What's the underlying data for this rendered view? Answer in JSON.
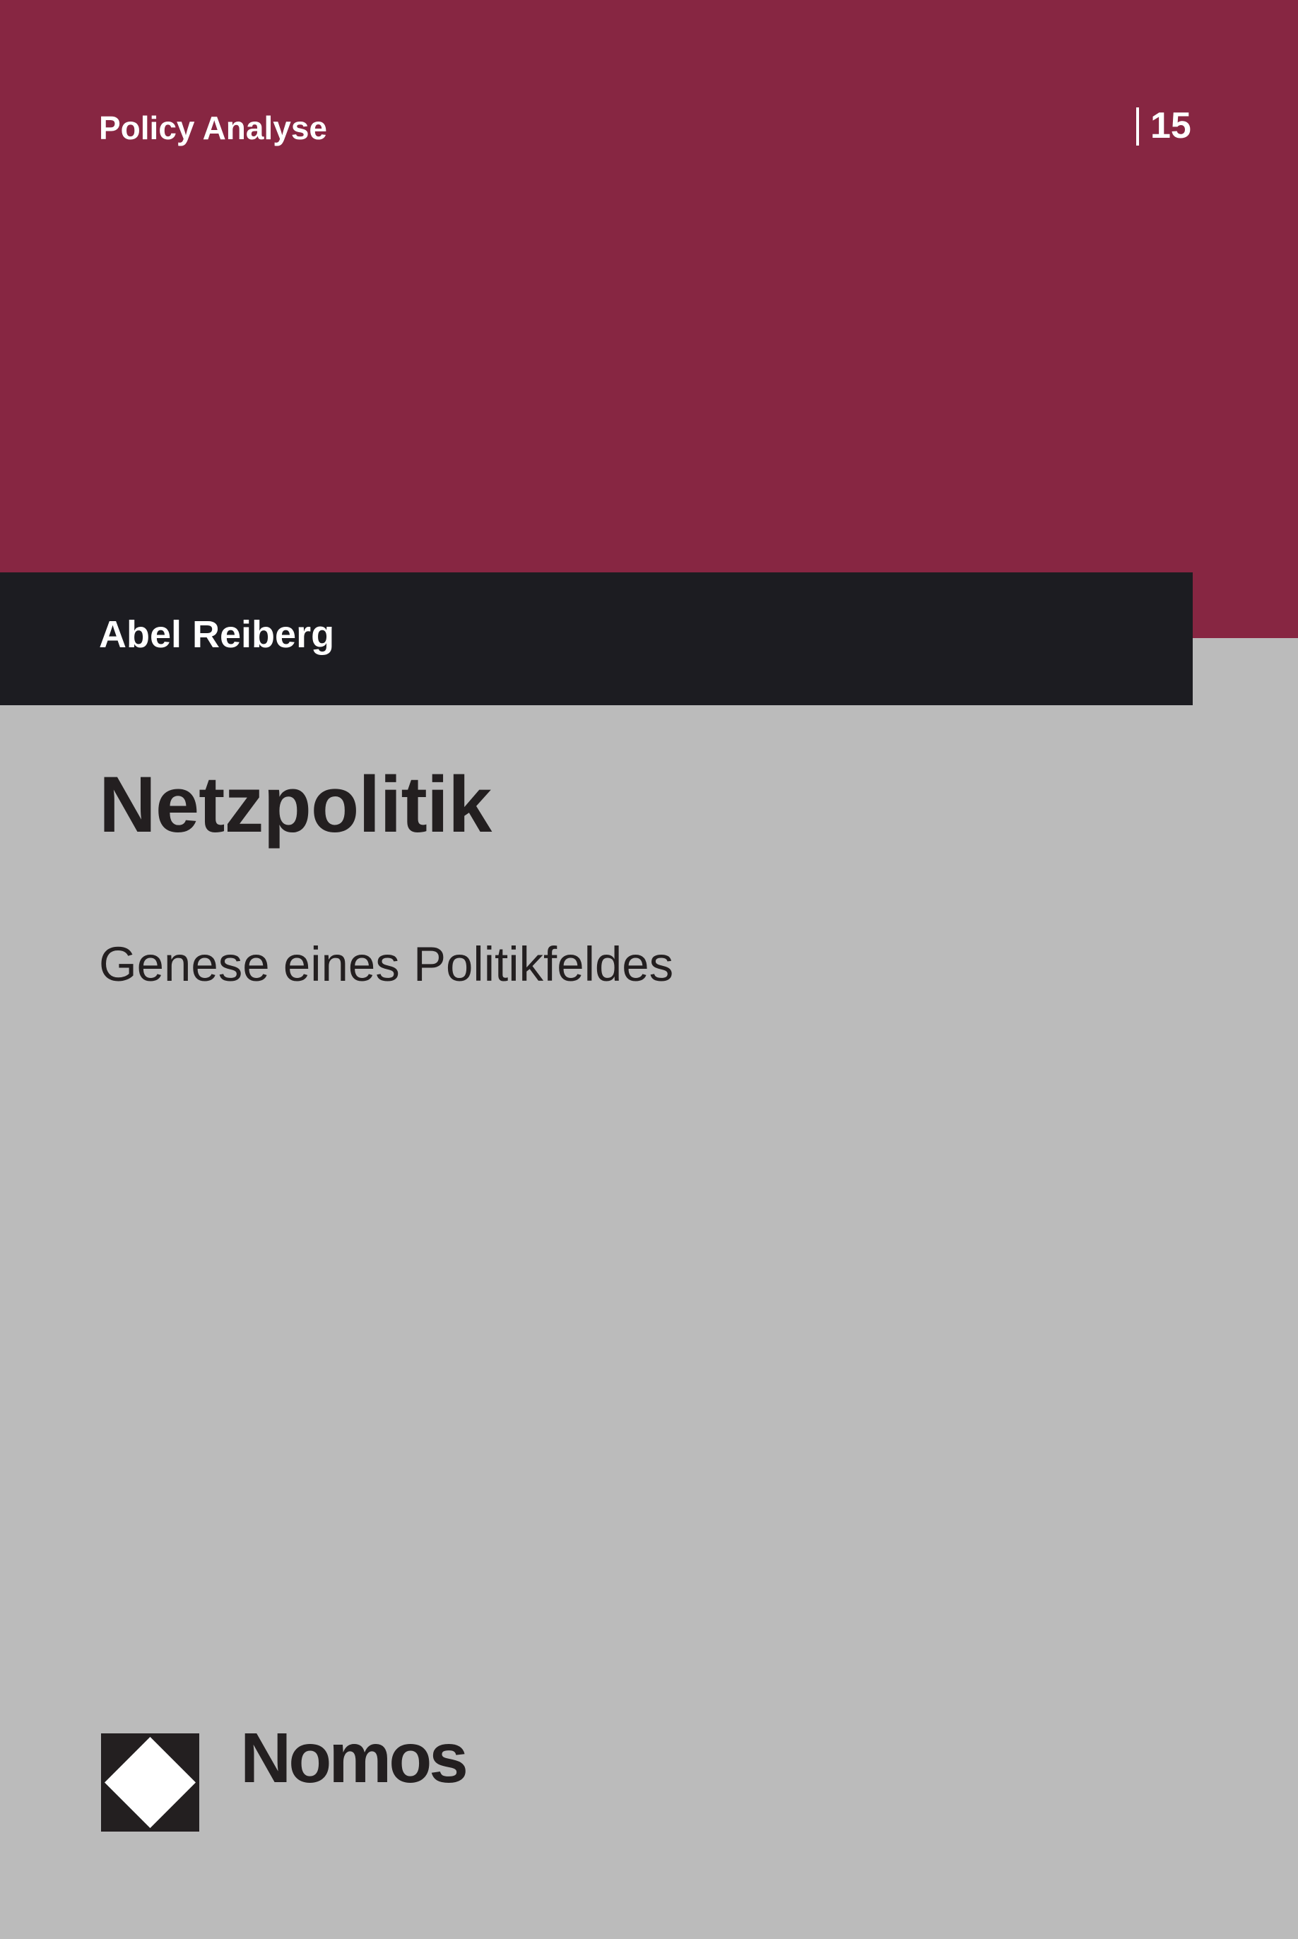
{
  "series": {
    "label": "Policy Analyse",
    "volume": "15"
  },
  "author": {
    "name": "Abel Reiberg"
  },
  "book": {
    "title": "Netzpolitik",
    "subtitle": "Genese eines Politikfeldes"
  },
  "publisher": {
    "name": "Nomos",
    "logo_icon": "nomos-diamond-logo-icon"
  },
  "colors": {
    "top_band": "#872642",
    "author_band": "#1c1c21",
    "background": "#bbbbbb",
    "text_dark": "#231f20",
    "text_light": "#ffffff"
  }
}
